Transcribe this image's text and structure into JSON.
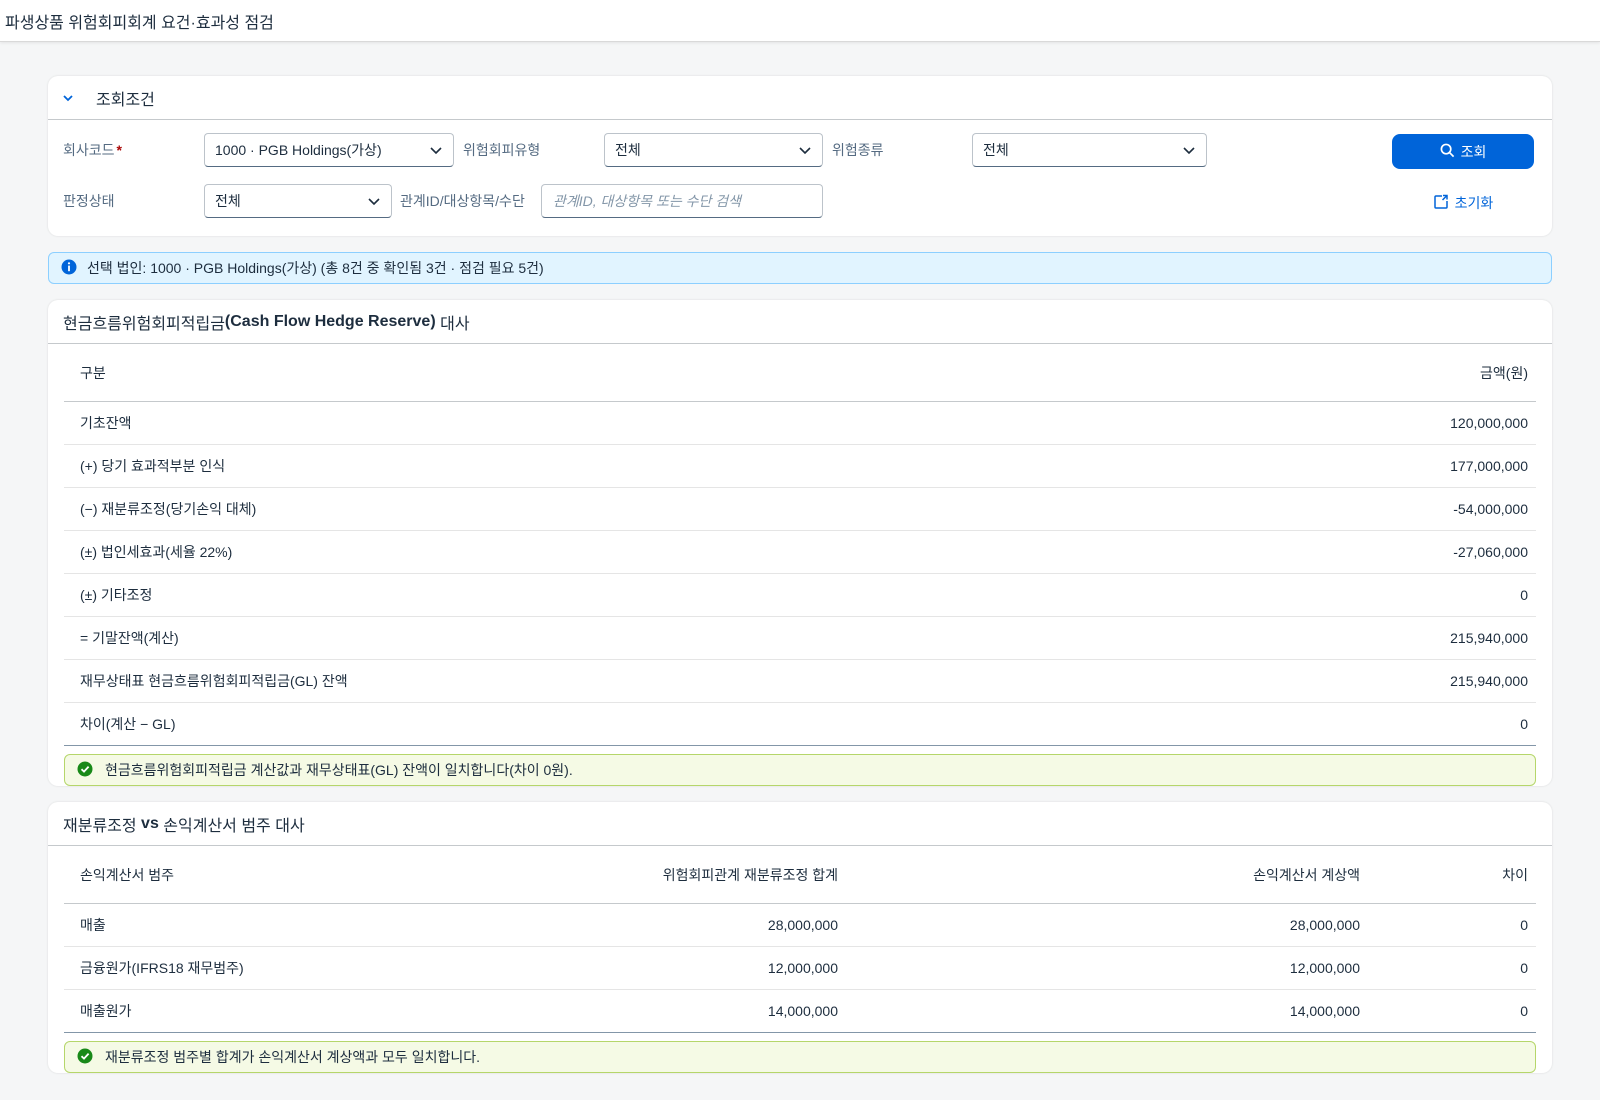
{
  "app": {
    "title": "파생상품 위험회피회계 요건·효과성 점검"
  },
  "filters": {
    "section_title": "조회조건",
    "company_label": "회사코드",
    "company_required_mark": "*",
    "company_value": "1000 · PGB Holdings(가상)",
    "hedge_type_label": "위험회피유형",
    "hedge_type_value": "전체",
    "risk_type_label": "위험종류",
    "risk_type_value": "전체",
    "status_label": "판정상태",
    "status_value": "전체",
    "search_label": "관계ID/대상항목/수단",
    "search_placeholder": "관계ID, 대상항목 또는 수단 검색",
    "search_button": "조회",
    "reset_button": "초기화"
  },
  "info": {
    "message": "선택 법인: 1000 · PGB Holdings(가상) (총 8건 중 확인됨 3건 · 점검 필요 5건)"
  },
  "cfhr": {
    "title_prefix": "현금흐름위험회피적립금",
    "title_bold": "(Cash Flow Hedge Reserve)",
    "title_suffix": " 대사",
    "col_item": "구분",
    "col_amount": "금액(원)",
    "rows": [
      {
        "label": "기초잔액",
        "amount": "120,000,000"
      },
      {
        "label": "(+) 당기 효과적부분 인식",
        "amount": "177,000,000"
      },
      {
        "label": "(−) 재분류조정(당기손익 대체)",
        "amount": "-54,000,000"
      },
      {
        "label": "(±) 법인세효과(세율 22%)",
        "amount": "-27,060,000"
      },
      {
        "label": "(±) 기타조정",
        "amount": "0"
      },
      {
        "label": "= 기말잔액(계산)",
        "amount": "215,940,000"
      },
      {
        "label": "재무상태표 현금흐름위험회피적립금(GL) 잔액",
        "amount": "215,940,000"
      },
      {
        "label": "차이(계산 − GL)",
        "amount": "0"
      }
    ],
    "success_message": "현금흐름위험회피적립금 계산값과 재무상태표(GL) 잔액이 일치합니다(차이 0원)."
  },
  "reclass": {
    "title_prefix": "재분류조정 ",
    "title_bold": "vs",
    "title_suffix": " 손익계산서 범주 대사",
    "col_category": "손익계산서 범주",
    "col_hedge_total": "위험회피관계 재분류조정 합계",
    "col_pl_amount": "손익계산서 계상액",
    "col_diff": "차이",
    "rows": [
      {
        "category": "매출",
        "hedge_total": "28,000,000",
        "pl_amount": "28,000,000",
        "diff": "0"
      },
      {
        "category": "금융원가(IFRS18 재무범주)",
        "hedge_total": "12,000,000",
        "pl_amount": "12,000,000",
        "diff": "0"
      },
      {
        "category": "매출원가",
        "hedge_total": "14,000,000",
        "pl_amount": "14,000,000",
        "diff": "0"
      }
    ],
    "success_message": "재분류조정 범주별 합계가 손익계산서 계상액과 모두 일치합니다."
  },
  "colors": {
    "accent": "#0064d9",
    "success": "#188918",
    "info": "#0064d9"
  }
}
